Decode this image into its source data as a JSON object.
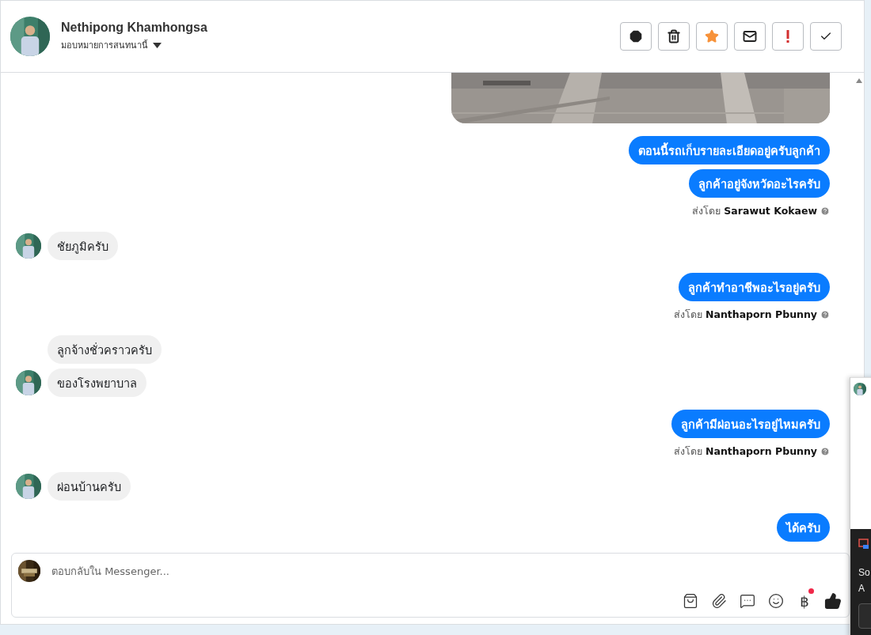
{
  "header": {
    "name": "Nethipong Khamhongsa",
    "assign_label": "มอบหมายการสนทนานี้"
  },
  "messages": [
    {
      "kind": "picture"
    },
    {
      "kind": "outgoing",
      "text": "ตอนนี้รถเก็บรายละเอียดอยู่ครับลูกค้า"
    },
    {
      "kind": "outgoing",
      "text": "ลูกค้าอยู่จังหวัดอะไรครับ"
    },
    {
      "kind": "sent_by",
      "prefix": "ส่งโดย",
      "sender": "Sarawut Kokaew"
    },
    {
      "kind": "incoming",
      "text": "ชัยภูมิครับ",
      "avatar": true
    },
    {
      "kind": "outgoing",
      "text": "ลูกค้าทำอาชีพอะไรอยู่ครับ"
    },
    {
      "kind": "sent_by",
      "prefix": "ส่งโดย",
      "sender": "Nanthaporn Pbunny"
    },
    {
      "kind": "incoming",
      "text": "ลูกจ้างชั่วคราวครับ",
      "avatar": false
    },
    {
      "kind": "incoming",
      "text": "ของโรงพยาบาล",
      "avatar": true
    },
    {
      "kind": "outgoing",
      "text": "ลูกค้ามีผ่อนอะไรอยู่ไหมครับ"
    },
    {
      "kind": "sent_by",
      "prefix": "ส่งโดย",
      "sender": "Nanthaporn Pbunny"
    },
    {
      "kind": "incoming",
      "text": "ผ่อนบ้านครับ",
      "avatar": true
    },
    {
      "kind": "outgoing",
      "text": "ได้ครับ"
    }
  ],
  "composer": {
    "placeholder": "ตอบกลับใน Messenger...",
    "currency_symbol": "฿",
    "notification_dot": true
  },
  "popup": {
    "line_1": "So",
    "line_2": "A"
  }
}
